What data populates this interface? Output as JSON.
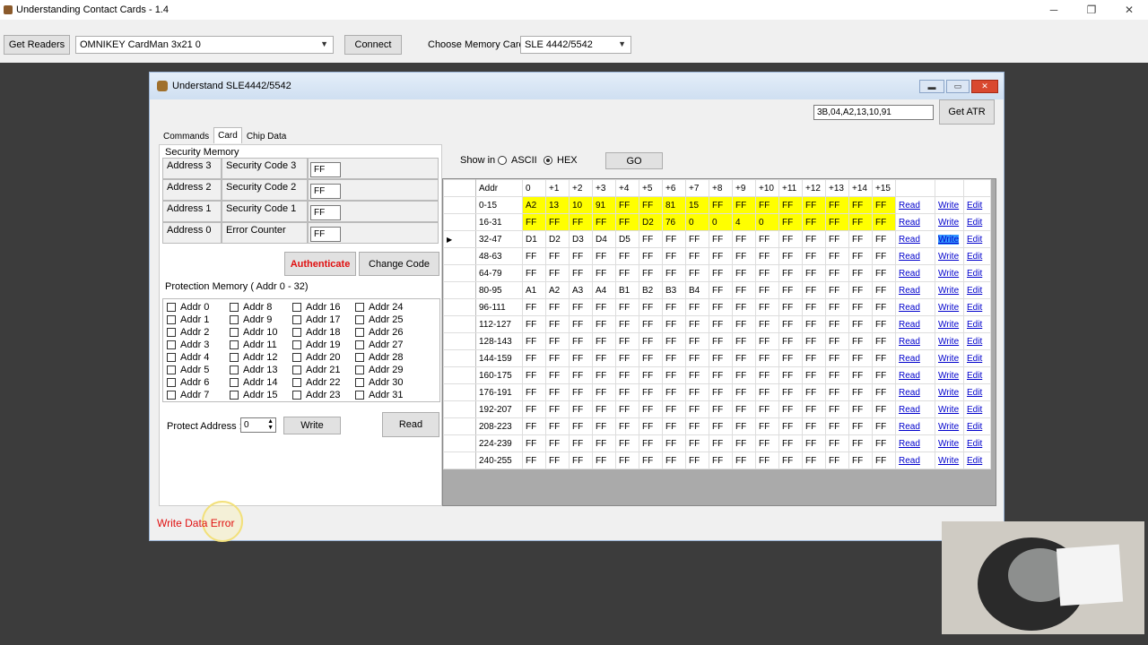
{
  "app": {
    "title": "Understanding Contact Cards - 1.4",
    "get_readers": "Get Readers",
    "reader": "OMNIKEY CardMan 3x21 0",
    "connect": "Connect",
    "choose_label": "Choose Memory Card :",
    "memory_card": "SLE 4442/5542"
  },
  "dialog": {
    "title": "Understand SLE4442/5542",
    "atr_value": "3B,04,A2,13,10,91",
    "get_atr": "Get ATR",
    "tabs": [
      "Commands",
      "Card",
      "Chip Data"
    ],
    "security_memory": "Security Memory",
    "sec_rows": [
      [
        "Address 3",
        "Security Code 3",
        "FF"
      ],
      [
        "Address 2",
        "Security Code 2",
        "FF"
      ],
      [
        "Address 1",
        "Security Code 1",
        "FF"
      ],
      [
        "Address 0",
        "Error Counter",
        "FF"
      ]
    ],
    "authenticate": "Authenticate",
    "change_code": "Change Code",
    "protection_label": "Protection Memory ( Addr 0 - 32)",
    "protect_address_label": "Protect Address :",
    "protect_value": "0",
    "write": "Write",
    "read": "Read",
    "show_in": "Show in",
    "ascii": "ASCII",
    "hex": "HEX",
    "go": "GO",
    "status": "Write Data Error"
  },
  "grid": {
    "headers": [
      "Addr",
      "0",
      "+1",
      "+2",
      "+3",
      "+4",
      "+5",
      "+6",
      "+7",
      "+8",
      "+9",
      "+10",
      "+11",
      "+12",
      "+13",
      "+14",
      "+15"
    ],
    "link_read": "Read",
    "link_write": "Write",
    "link_edit": "Edit",
    "rows": [
      [
        "0-15",
        "A2",
        "13",
        "10",
        "91",
        "FF",
        "FF",
        "81",
        "15",
        "FF",
        "FF",
        "FF",
        "FF",
        "FF",
        "FF",
        "FF",
        "FF"
      ],
      [
        "16-31",
        "FF",
        "FF",
        "FF",
        "FF",
        "FF",
        "D2",
        "76",
        "0",
        "0",
        "4",
        "0",
        "FF",
        "FF",
        "FF",
        "FF",
        "FF"
      ],
      [
        "32-47",
        "D1",
        "D2",
        "D3",
        "D4",
        "D5",
        "FF",
        "FF",
        "FF",
        "FF",
        "FF",
        "FF",
        "FF",
        "FF",
        "FF",
        "FF",
        "FF"
      ],
      [
        "48-63",
        "FF",
        "FF",
        "FF",
        "FF",
        "FF",
        "FF",
        "FF",
        "FF",
        "FF",
        "FF",
        "FF",
        "FF",
        "FF",
        "FF",
        "FF",
        "FF"
      ],
      [
        "64-79",
        "FF",
        "FF",
        "FF",
        "FF",
        "FF",
        "FF",
        "FF",
        "FF",
        "FF",
        "FF",
        "FF",
        "FF",
        "FF",
        "FF",
        "FF",
        "FF"
      ],
      [
        "80-95",
        "A1",
        "A2",
        "A3",
        "A4",
        "B1",
        "B2",
        "B3",
        "B4",
        "FF",
        "FF",
        "FF",
        "FF",
        "FF",
        "FF",
        "FF",
        "FF"
      ],
      [
        "96-111",
        "FF",
        "FF",
        "FF",
        "FF",
        "FF",
        "FF",
        "FF",
        "FF",
        "FF",
        "FF",
        "FF",
        "FF",
        "FF",
        "FF",
        "FF",
        "FF"
      ],
      [
        "112-127",
        "FF",
        "FF",
        "FF",
        "FF",
        "FF",
        "FF",
        "FF",
        "FF",
        "FF",
        "FF",
        "FF",
        "FF",
        "FF",
        "FF",
        "FF",
        "FF"
      ],
      [
        "128-143",
        "FF",
        "FF",
        "FF",
        "FF",
        "FF",
        "FF",
        "FF",
        "FF",
        "FF",
        "FF",
        "FF",
        "FF",
        "FF",
        "FF",
        "FF",
        "FF"
      ],
      [
        "144-159",
        "FF",
        "FF",
        "FF",
        "FF",
        "FF",
        "FF",
        "FF",
        "FF",
        "FF",
        "FF",
        "FF",
        "FF",
        "FF",
        "FF",
        "FF",
        "FF"
      ],
      [
        "160-175",
        "FF",
        "FF",
        "FF",
        "FF",
        "FF",
        "FF",
        "FF",
        "FF",
        "FF",
        "FF",
        "FF",
        "FF",
        "FF",
        "FF",
        "FF",
        "FF"
      ],
      [
        "176-191",
        "FF",
        "FF",
        "FF",
        "FF",
        "FF",
        "FF",
        "FF",
        "FF",
        "FF",
        "FF",
        "FF",
        "FF",
        "FF",
        "FF",
        "FF",
        "FF"
      ],
      [
        "192-207",
        "FF",
        "FF",
        "FF",
        "FF",
        "FF",
        "FF",
        "FF",
        "FF",
        "FF",
        "FF",
        "FF",
        "FF",
        "FF",
        "FF",
        "FF",
        "FF"
      ],
      [
        "208-223",
        "FF",
        "FF",
        "FF",
        "FF",
        "FF",
        "FF",
        "FF",
        "FF",
        "FF",
        "FF",
        "FF",
        "FF",
        "FF",
        "FF",
        "FF",
        "FF"
      ],
      [
        "224-239",
        "FF",
        "FF",
        "FF",
        "FF",
        "FF",
        "FF",
        "FF",
        "FF",
        "FF",
        "FF",
        "FF",
        "FF",
        "FF",
        "FF",
        "FF",
        "FF"
      ],
      [
        "240-255",
        "FF",
        "FF",
        "FF",
        "FF",
        "FF",
        "FF",
        "FF",
        "FF",
        "FF",
        "FF",
        "FF",
        "FF",
        "FF",
        "FF",
        "FF",
        "FF"
      ]
    ]
  },
  "colors": {
    "highlight": "#ffff00",
    "error": "#e01010",
    "link": "#0000cc"
  },
  "icons": {
    "app": "card-reader-icon",
    "min": "minimize-icon",
    "max": "maximize-icon",
    "close": "close-icon"
  }
}
